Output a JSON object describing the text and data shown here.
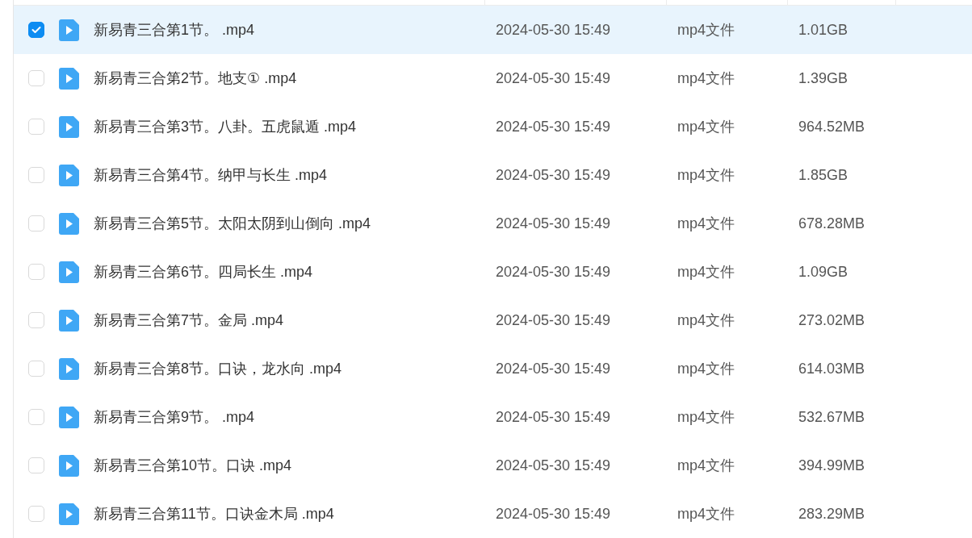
{
  "files": [
    {
      "name": "新易青三合第1节。 .mp4",
      "modified": "2024-05-30 15:49",
      "type": "mp4文件",
      "size": "1.01GB",
      "selected": true
    },
    {
      "name": "新易青三合第2节。地支① .mp4",
      "modified": "2024-05-30 15:49",
      "type": "mp4文件",
      "size": "1.39GB",
      "selected": false
    },
    {
      "name": "新易青三合第3节。八卦。五虎鼠遁 .mp4",
      "modified": "2024-05-30 15:49",
      "type": "mp4文件",
      "size": "964.52MB",
      "selected": false
    },
    {
      "name": "新易青三合第4节。纳甲与长生 .mp4",
      "modified": "2024-05-30 15:49",
      "type": "mp4文件",
      "size": "1.85GB",
      "selected": false
    },
    {
      "name": "新易青三合第5节。太阳太阴到山倒向 .mp4",
      "modified": "2024-05-30 15:49",
      "type": "mp4文件",
      "size": "678.28MB",
      "selected": false
    },
    {
      "name": "新易青三合第6节。四局长生 .mp4",
      "modified": "2024-05-30 15:49",
      "type": "mp4文件",
      "size": "1.09GB",
      "selected": false
    },
    {
      "name": "新易青三合第7节。金局 .mp4",
      "modified": "2024-05-30 15:49",
      "type": "mp4文件",
      "size": "273.02MB",
      "selected": false
    },
    {
      "name": "新易青三合第8节。口诀，龙水向 .mp4",
      "modified": "2024-05-30 15:49",
      "type": "mp4文件",
      "size": "614.03MB",
      "selected": false
    },
    {
      "name": "新易青三合第9节。 .mp4",
      "modified": "2024-05-30 15:49",
      "type": "mp4文件",
      "size": "532.67MB",
      "selected": false
    },
    {
      "name": "新易青三合第10节。口诀 .mp4",
      "modified": "2024-05-30 15:49",
      "type": "mp4文件",
      "size": "394.99MB",
      "selected": false
    },
    {
      "name": "新易青三合第11节。口诀金木局 .mp4",
      "modified": "2024-05-30 15:49",
      "type": "mp4文件",
      "size": "283.29MB",
      "selected": false
    }
  ]
}
